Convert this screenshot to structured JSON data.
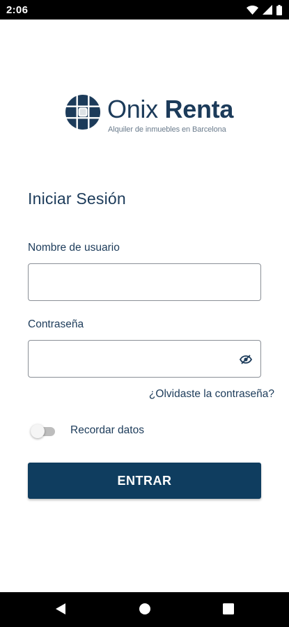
{
  "status_bar": {
    "time": "2:06",
    "icons": [
      "wifi-icon",
      "cellular-signal-icon",
      "battery-icon"
    ]
  },
  "logo": {
    "name_light": "Onix ",
    "name_bold": "Renta",
    "tagline": "Alquiler de inmuebles en Barcelona"
  },
  "form": {
    "title": "Iniciar Sesión",
    "username": {
      "label": "Nombre de usuario",
      "value": "",
      "placeholder": ""
    },
    "password": {
      "label": "Contraseña",
      "value": "",
      "placeholder": "",
      "visibility_icon": "eye-off-icon"
    },
    "forgot_password": "¿Olvidaste la contraseña?",
    "remember": {
      "label": "Recordar datos",
      "checked": false
    },
    "submit_label": "ENTRAR"
  },
  "nav_bar": {
    "buttons": [
      "back-icon",
      "home-icon",
      "recents-icon"
    ]
  },
  "colors": {
    "brand": "#1c3b5a",
    "button": "#0f3d5f",
    "tagline": "#6a7b8c",
    "toggle_off": "#bdbdbd"
  }
}
